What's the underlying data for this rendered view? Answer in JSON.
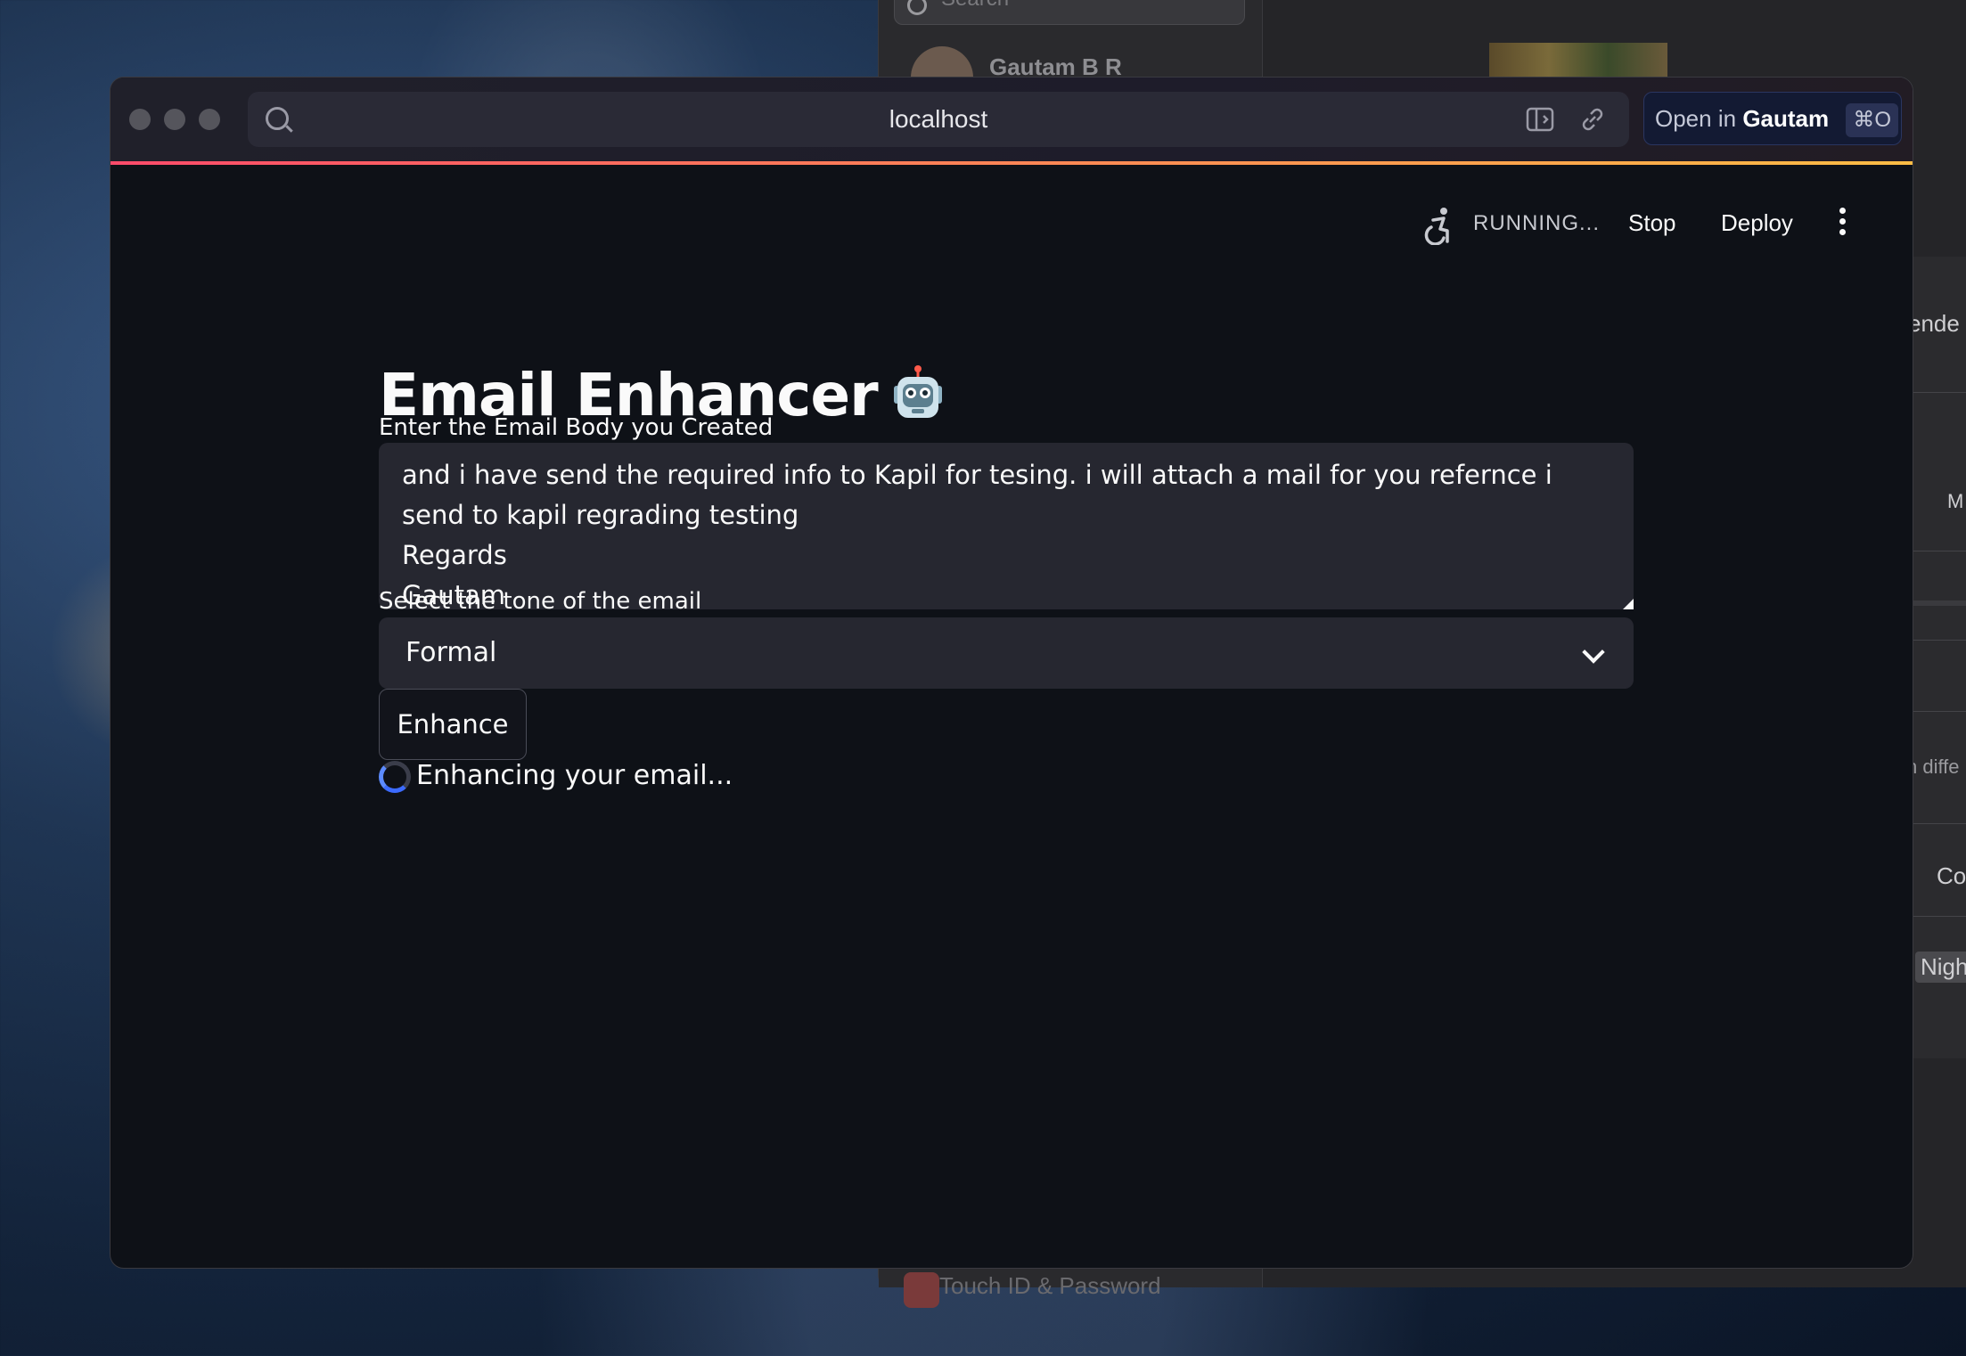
{
  "desktop": {
    "background_app": {
      "search_placeholder": "Search",
      "user_name": "Gautam B R",
      "bottom_item": "Touch ID & Password"
    },
    "right_panel": {
      "fragments": [
        "ende",
        "M",
        "n diffe",
        "Co",
        "Nigh"
      ]
    }
  },
  "browser": {
    "url": "localhost",
    "open_in": {
      "prefix": "Open in",
      "target": "Gautam",
      "shortcut": "⌘O"
    }
  },
  "header": {
    "status": "RUNNING...",
    "stop_label": "Stop",
    "deploy_label": "Deploy"
  },
  "app": {
    "title": "Email Enhancer",
    "title_icon": "robot-emoji",
    "email_body_label": "Enter the Email Body you Created",
    "email_body_value": "and i have send the required info to Kapil for tesing. i will attach a mail for you refernce i send to kapil regrading testing\nRegards\nGautam",
    "tone_label": "Select the tone of the email",
    "tone_value": "Formal",
    "enhance_label": "Enhance",
    "status_text": "Enhancing your email..."
  },
  "colors": {
    "background": "#0e1117",
    "input_background": "#262730",
    "text": "#fafafa",
    "accent_gradient_start": "#ff4b6a",
    "accent_gradient_end": "#ffbd45",
    "spinner": "#5c8bff"
  }
}
